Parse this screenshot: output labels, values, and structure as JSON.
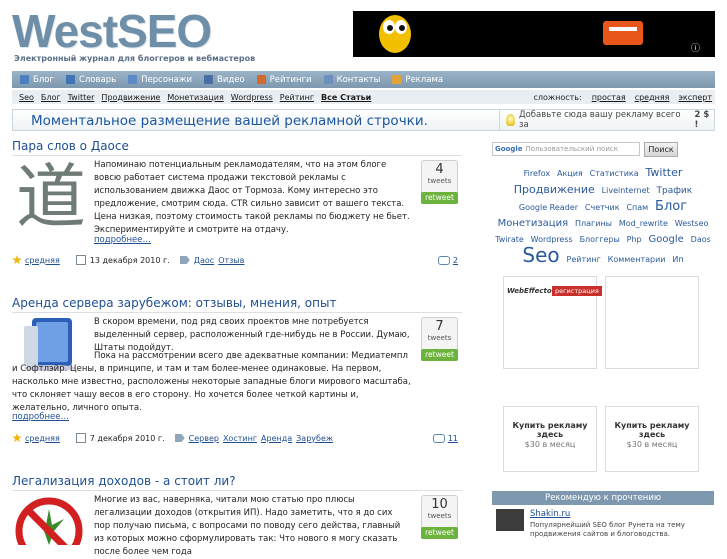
{
  "header": {
    "logo": "WestSEO",
    "tagline": "Электронный журнал для блоггеров и вебмастеров"
  },
  "nav": {
    "items": [
      {
        "label": "Блог",
        "icon": "blog-icon",
        "color": "#4a7fc1"
      },
      {
        "label": "Словарь",
        "icon": "book-icon",
        "color": "#3f74b5"
      },
      {
        "label": "Персонажи",
        "icon": "person-icon",
        "color": "#5d8ac4"
      },
      {
        "label": "Видео",
        "icon": "video-icon",
        "color": "#4a6fa5"
      },
      {
        "label": "Рейтинги",
        "icon": "chart-icon",
        "color": "#d26a2f"
      },
      {
        "label": "Контакты",
        "icon": "mail-icon",
        "color": "#6b90bd"
      },
      {
        "label": "Реклама",
        "icon": "ad-icon",
        "color": "#e3a33a"
      }
    ]
  },
  "subnav": {
    "links": [
      "Seo",
      "Блог",
      "Twitter",
      "Продвижение",
      "Монетизация",
      "Wordpress",
      "Рейтинг"
    ],
    "all_articles": "Все Статьи",
    "difficulty_label": "сложность:",
    "difficulty": [
      "простая",
      "средняя",
      "эксперт"
    ]
  },
  "adstrip": {
    "main": "Моментальное размещение вашей рекламной строчки.",
    "side": "Добавьте сюда вашу рекламу всего за",
    "price": "2 $ !"
  },
  "posts": [
    {
      "title": "Пара слов о Даосе",
      "text": "Напоминаю потенциальным рекламодателям, что на этом блоге вовсю работает система продажи текстовой рекламы с использованием движка Даос от Тормоза. Кому интересно это предложение, смотрим сюда. CTR сильно зависит от вашего текста. Цена низкая, поэтому стоимость такой рекламы по бюджету не бьет. Экспериментируйте и смотрите на отдачу.",
      "more": "подробнее…",
      "tweets": "4",
      "tweets_label": "tweets",
      "retweet": "retweet",
      "difficulty": "средняя",
      "date": "13 декабря 2010 г.",
      "tags": [
        "Даос",
        "Отзыв"
      ],
      "comments": "2"
    },
    {
      "title": "Аренда сервера зарубежом: отзывы, мнения, опыт",
      "text1": "В скором времени, под ряд своих проектов мне потребуется выделенный сервер, расположенный где-нибудь не в России. Думаю, Штаты подойдут.",
      "text2": "Пока на рассмотрении всего две адекватные компании: Медиатемпл и Софтлэйр. Цены, в принципе, и там и там более-менее одинаковые. На первом, насколько мне известно, расположены некоторые западные блоги мирового масштаба, что склоняет чашу весов в его сторону. Но хочется более четкой картины и, желательно, личного опыта.",
      "more": "подробнее…",
      "tweets": "7",
      "tweets_label": "tweets",
      "retweet": "retweet",
      "difficulty": "средняя",
      "date": "7 декабря 2010 г.",
      "tags": [
        "Сервер",
        "Хостинг",
        "Аренда",
        "Зарубеж"
      ],
      "comments": "11"
    },
    {
      "title": "Легализация доходов - а стоит ли?",
      "text": "Многие из вас, наверняка, читали мою статью про плюсы легализации доходов (открытия ИП). Надо заметить, что я до сих пор получаю письма, с вопросами по поводу сего действа, главный из которых можно сформулировать так: Что нового я могу сказать после более чем года",
      "tweets": "10",
      "tweets_label": "tweets",
      "retweet": "retweet"
    }
  ],
  "sidebar": {
    "search_placeholder": "Пользовательский поиск",
    "search_brand": "Google",
    "search_button": "Поиск",
    "cloud": [
      {
        "t": "Firefox",
        "s": 8
      },
      {
        "t": "Акция",
        "s": 8
      },
      {
        "t": "Статистика",
        "s": 8
      },
      {
        "t": "Twitter",
        "s": 11
      },
      {
        "t": "Продвижение",
        "s": 11
      },
      {
        "t": "Liveinternet",
        "s": 8
      },
      {
        "t": "Трафик",
        "s": 9
      },
      {
        "t": "Google Reader",
        "s": 8
      },
      {
        "t": "Счетчик",
        "s": 8
      },
      {
        "t": "Спам",
        "s": 8
      },
      {
        "t": "Блог",
        "s": 13
      },
      {
        "t": "Монетизация",
        "s": 10
      },
      {
        "t": "Плагины",
        "s": 8
      },
      {
        "t": "Mod_rewrite",
        "s": 8
      },
      {
        "t": "Westseo",
        "s": 8
      },
      {
        "t": "Twirate",
        "s": 8
      },
      {
        "t": "Wordpress",
        "s": 8
      },
      {
        "t": "Блоггеры",
        "s": 8
      },
      {
        "t": "Php",
        "s": 8
      },
      {
        "t": "Google",
        "s": 10
      },
      {
        "t": "Daos",
        "s": 8
      },
      {
        "t": "Seo",
        "s": 20
      },
      {
        "t": "Рейтинг",
        "s": 8
      },
      {
        "t": "Комментарии",
        "s": 8
      },
      {
        "t": "Ип",
        "s": 8
      }
    ],
    "ad1_brand": "WebEffector",
    "ad1_button": "регистрация",
    "buy_title": "Купить рекламу здесь",
    "buy_price": "$30 в месяц",
    "rec_header": "Рекомендую к прочтению",
    "rec_title": "Shakin.ru",
    "rec_text": "Популярнейший SEO блог Рунета на тему продвижения сайтов и блоговодства."
  }
}
